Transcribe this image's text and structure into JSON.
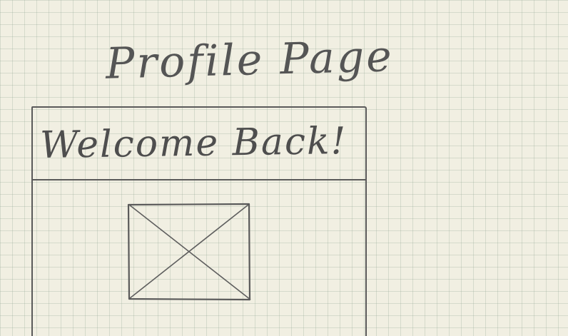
{
  "page": {
    "title": "Profile Page"
  },
  "header": {
    "welcome": "Welcome Back!"
  },
  "profile": {
    "image_icon": "image-placeholder-icon"
  },
  "colors": {
    "paper": "#f1efe2",
    "grid": "#96a896",
    "pencil": "#5a5a5a"
  }
}
